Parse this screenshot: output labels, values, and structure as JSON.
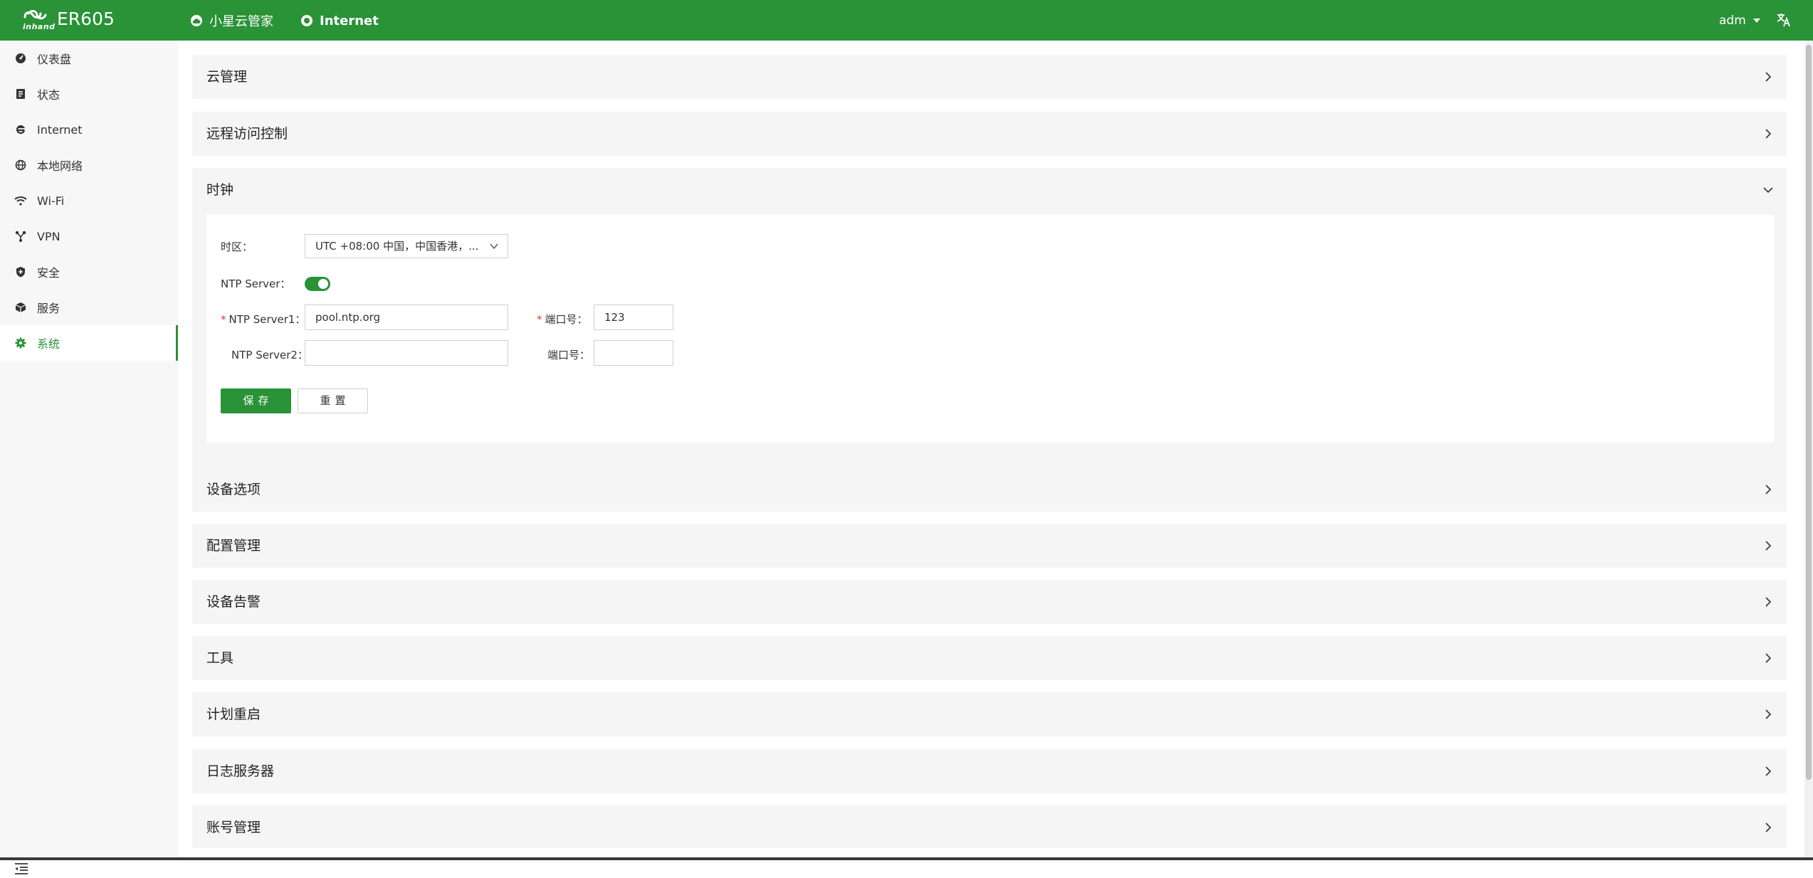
{
  "header": {
    "brand_sub": "inhand",
    "product": "ER605",
    "cloud_status": "小星云管家",
    "internet_status": "Internet",
    "user": "adm",
    "language_icon": "translate-icon"
  },
  "sidebar": {
    "items": [
      {
        "label": "仪表盘",
        "icon": "dashboard-icon"
      },
      {
        "label": "状态",
        "icon": "status-icon"
      },
      {
        "label": "Internet",
        "icon": "internet-icon"
      },
      {
        "label": "本地网络",
        "icon": "globe-icon"
      },
      {
        "label": "Wi-Fi",
        "icon": "wifi-icon"
      },
      {
        "label": "VPN",
        "icon": "vpn-icon"
      },
      {
        "label": "安全",
        "icon": "shield-icon"
      },
      {
        "label": "服务",
        "icon": "cube-icon"
      },
      {
        "label": "系统",
        "icon": "gear-icon",
        "active": true
      }
    ],
    "collapse_icon": "menu-collapse-icon"
  },
  "panels": {
    "cloud": "云管理",
    "remote": "远程访问控制",
    "clock": "时钟",
    "device_options": "设备选项",
    "config": "配置管理",
    "alarm": "设备告警",
    "tools": "工具",
    "reboot": "计划重启",
    "log_server": "日志服务器",
    "account": "账号管理"
  },
  "clock_form": {
    "timezone_label": "时区：",
    "timezone_value": "UTC +08:00 中国，中国香港，...",
    "ntp_server_label": "NTP Server：",
    "ntp_server_enabled": true,
    "required_mark": "*",
    "ntp1_label": "NTP Server1：",
    "ntp1_value": "pool.ntp.org",
    "port1_label": "端口号：",
    "port1_value": "123",
    "ntp2_label": "NTP Server2：",
    "ntp2_value": "",
    "port2_label": "端口号：",
    "port2_value": "",
    "save_label": "保存",
    "reset_label": "重置"
  },
  "colors": {
    "brand_green": "#2a9237",
    "required_red": "#e53935",
    "panel_bg": "#f5f5f5",
    "sidebar_bg": "#f7f7f7"
  }
}
